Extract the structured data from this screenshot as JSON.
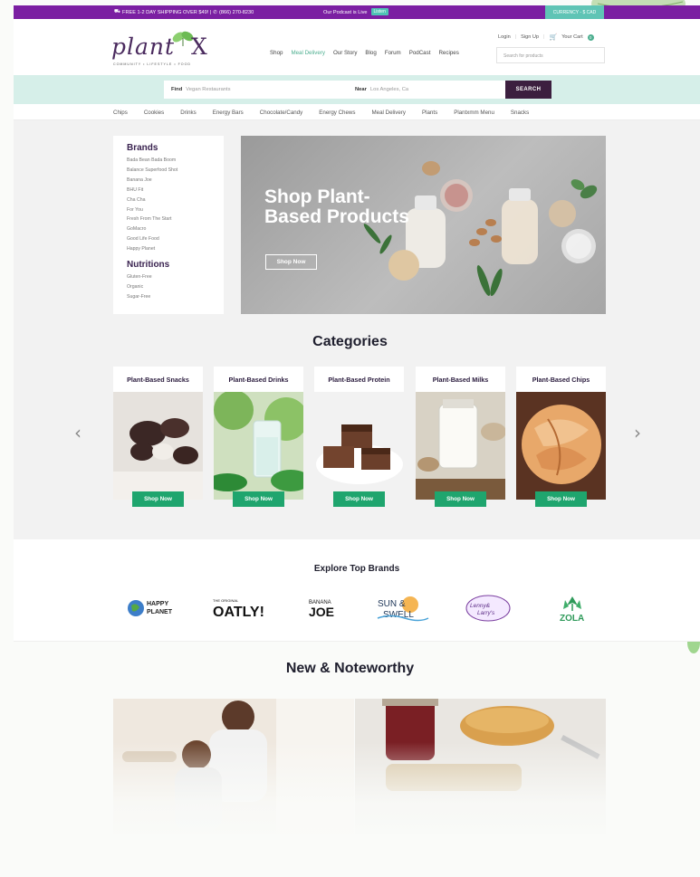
{
  "topbar": {
    "shipping_text": "FREE 1-2 DAY SHIPPING OVER $49! | ",
    "phone": "(866) 270-8230",
    "podcast_text": "Our Podcast is Live",
    "listen_label": "Listen",
    "currency_label": "CURRENCY - $ CAD"
  },
  "header": {
    "logo_word": "plant",
    "logo_x": "X",
    "logo_tagline": "COMMUNITY  •  LIFESTYLE  •  FOOD",
    "nav": [
      "Shop",
      "Meal Delivery",
      "Our Story",
      "Blog",
      "Forum",
      "PodCast",
      "Recipes"
    ],
    "active_nav": "Meal Delivery",
    "login_label": "Login",
    "signup_label": "Sign Up",
    "cart_label": "Your Cart",
    "cart_count": "0",
    "search_placeholder": "Search for products"
  },
  "findbar": {
    "find_label": "Find",
    "find_placeholder": "Vegan Restaurants",
    "near_label": "Near",
    "near_placeholder": "Los Angeles, Ca",
    "search_button": "SEARCH"
  },
  "category_nav": [
    "Chips",
    "Cookies",
    "Drinks",
    "Energy Bars",
    "Chocolate/Candy",
    "Energy Chews",
    "Meal Delivery",
    "Plants",
    "Plantxmm Menu",
    "Snacks"
  ],
  "sidebar": {
    "brands_heading": "Brands",
    "brands": [
      "Bada Bean Bada Boom",
      "Balance Superfood Shot",
      "Banana Joe",
      "BHU Fit",
      "Cha Cha",
      "For You",
      "Fresh From The Start",
      "GoMacro",
      "Good Life Food",
      "Happy Planet"
    ],
    "nutritions_heading": "Nutritions",
    "nutritions": [
      "Gluten-Free",
      "Organic",
      "Sugar-Free"
    ]
  },
  "hero": {
    "title": "Shop Plant-Based Products",
    "button": "Shop Now"
  },
  "categories": {
    "title": "Categories",
    "items": [
      {
        "label": "Plant-Based Snacks",
        "button": "Shop Now"
      },
      {
        "label": "Plant-Based Drinks",
        "button": "Shop Now"
      },
      {
        "label": "Plant-Based Protein",
        "button": "Shop Now"
      },
      {
        "label": "Plant-Based Milks",
        "button": "Shop Now"
      },
      {
        "label": "Plant-Based Chips",
        "button": "Shop Now"
      }
    ],
    "prev_arrow": "‹",
    "next_arrow": "›"
  },
  "brands_section": {
    "title": "Explore Top Brands",
    "logos": [
      "HAPPY PLANET",
      "OATLY!",
      "BANANA JOE",
      "SUN & SWELL",
      "Lenny & Larry's",
      "ZOLA"
    ]
  },
  "new_section": {
    "title": "New & Noteworthy"
  },
  "colors": {
    "topbar": "#7b1fa2",
    "accent_green": "#1fa56e",
    "search_button": "#3c1f3f",
    "findbar_bg": "#d6efe9"
  }
}
